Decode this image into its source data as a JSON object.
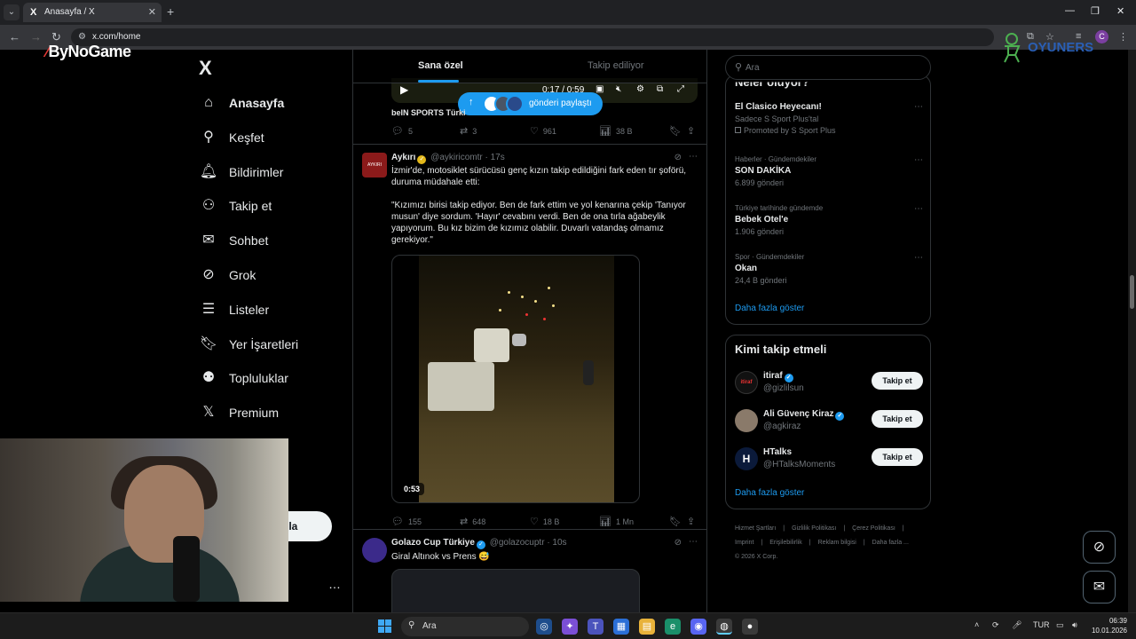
{
  "browser": {
    "tab_title": "Anasayfa / X",
    "url": "x.com/home",
    "tab_favicon": "X"
  },
  "watermarks": {
    "bynogame": "ByNoGame",
    "oyuncu": "OYUNERS"
  },
  "sidebar": {
    "logo": "X",
    "items": [
      {
        "label": "Anasayfa",
        "icon": "home-icon",
        "glyph": "⌂"
      },
      {
        "label": "Keşfet",
        "icon": "search-icon",
        "glyph": "⚲"
      },
      {
        "label": "Bildirimler",
        "icon": "bell-icon",
        "glyph": "🔔︎"
      },
      {
        "label": "Takip et",
        "icon": "follow-icon",
        "glyph": "⚇"
      },
      {
        "label": "Sohbet",
        "icon": "mail-icon",
        "glyph": "✉"
      },
      {
        "label": "Grok",
        "icon": "grok-icon",
        "glyph": "⊘"
      },
      {
        "label": "Listeler",
        "icon": "list-icon",
        "glyph": "☰"
      },
      {
        "label": "Yer İşaretleri",
        "icon": "bookmark-icon",
        "glyph": "🔖︎"
      },
      {
        "label": "Topluluklar",
        "icon": "communities-icon",
        "glyph": "⚉"
      },
      {
        "label": "Premium",
        "icon": "x-premium-icon",
        "glyph": "𝕏"
      }
    ],
    "post_button_partial": "nla",
    "more": "…"
  },
  "feed_tabs": {
    "for_you": "Sana özel",
    "following": "Takip ediliyor"
  },
  "top_video": {
    "time": "0:17 / 0:59",
    "source": "beIN SPORTS Türki"
  },
  "share_pill": {
    "label": "gönderi paylaştı"
  },
  "top_actions": {
    "replies": "5",
    "reposts": "3",
    "likes": "961",
    "views": "38 B"
  },
  "tweet1": {
    "name": "Aykırı",
    "handle": "@aykiricomtr",
    "time": "· 17s",
    "avatar_text": "AYKIRI",
    "text": "İzmir'de, motosiklet sürücüsü genç kızın takip edildiğini fark eden tır şoförü, duruma müdahale etti:\n\n\"Kızımızı birisi takip ediyor. Ben de fark ettim ve yol kenarına çekip 'Tanıyor musun' diye sordum. 'Hayır' cevabını verdi. Ben de ona tırla ağabeylik yapıyorum. Bu kız bizim de kızımız olabilir. Duvarlı vatandaş olmamız gerekiyor.\"",
    "duration": "0:53",
    "replies": "155",
    "reposts": "648",
    "likes": "18 B",
    "views": "1 Mn"
  },
  "tweet2": {
    "name": "Golazo Cup Türkiye",
    "handle": "@golazocuptr",
    "time": "· 10s",
    "text": "Giral Altınok vs Prens 😅"
  },
  "search": {
    "placeholder": "Ara"
  },
  "trends": {
    "title": "Neler oluyor?",
    "items": [
      {
        "context": "",
        "name": "El Clasico Heyecanı!",
        "sub": "Sadece S Sport Plus'tal",
        "promo": "Promoted by S Sport Plus"
      },
      {
        "context": "Haberler · Gündemdekiler",
        "name": "SON DAKİKA",
        "sub": "6.899 gönderi",
        "promo": ""
      },
      {
        "context": "Türkiye tarihinde gündemde",
        "name": "Bebek Otel'e",
        "sub": "1.906 gönderi",
        "promo": ""
      },
      {
        "context": "Spor · Gündemdekiler",
        "name": "Okan",
        "sub": "24,4 B gönderi",
        "promo": ""
      }
    ],
    "show_more": "Daha fazla göster"
  },
  "who_to_follow": {
    "title": "Kimi takip etmeli",
    "items": [
      {
        "name": "itiraf",
        "handle": "@gizlilsun",
        "button": "Takip et",
        "avatar_text": "itiraf"
      },
      {
        "name": "Ali Güvenç Kiraz",
        "handle": "@agkiraz",
        "button": "Takip et",
        "avatar_text": ""
      },
      {
        "name": "HTalks",
        "handle": "@HTalksMoments",
        "button": "Takip et",
        "avatar_text": "H"
      }
    ],
    "show_more": "Daha fazla göster"
  },
  "footer": {
    "links": [
      "Hizmet Şartları",
      "|",
      "Gizlilik Politikası",
      "|",
      "Çerez Politikası",
      "|",
      "Imprint",
      "|",
      "Erişilebilirlik",
      "|",
      "Reklam bilgisi",
      "|",
      "Daha fazla ..."
    ],
    "copyright": "© 2026 X Corp."
  },
  "taskbar": {
    "search": "Ara",
    "lang": "TUR",
    "time": "06:39",
    "date": "10.01.2026"
  },
  "colors": {
    "accent": "#1d9bf0",
    "background": "#000000",
    "border": "#2f3336",
    "muted": "#71767b"
  }
}
